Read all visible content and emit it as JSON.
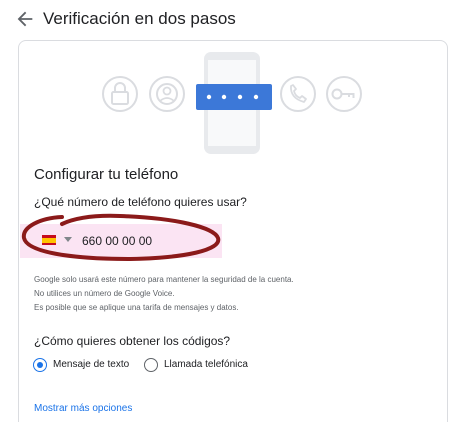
{
  "header": {
    "back_icon": "arrow-back-icon",
    "title": "Verificación en dos pasos"
  },
  "illustration": {
    "icons": [
      "lock-icon",
      "account-icon",
      "phone-icon",
      "key-icon"
    ],
    "pin_mask": "• • • •",
    "accent_color": "#3c78d8"
  },
  "setup": {
    "title": "Configurar tu teléfono",
    "question": "¿Qué número de teléfono quieres usar?",
    "country_flag": "spain-flag-icon",
    "phone_value": "660 00 00 00",
    "help_lines": [
      "Google solo usará este número para mantener la seguridad de la cuenta.",
      "No utilices un número de Google Voice.",
      "Es posible que se aplique una tarifa de mensajes y datos."
    ]
  },
  "codes": {
    "question": "¿Cómo quieres obtener los códigos?",
    "options": [
      {
        "label": "Mensaje de texto",
        "checked": true
      },
      {
        "label": "Llamada telefónica",
        "checked": false
      }
    ]
  },
  "more_options": "Mostrar más opciones",
  "colors": {
    "link": "#1a73e8",
    "annotation_ink": "#8b1a1a"
  }
}
